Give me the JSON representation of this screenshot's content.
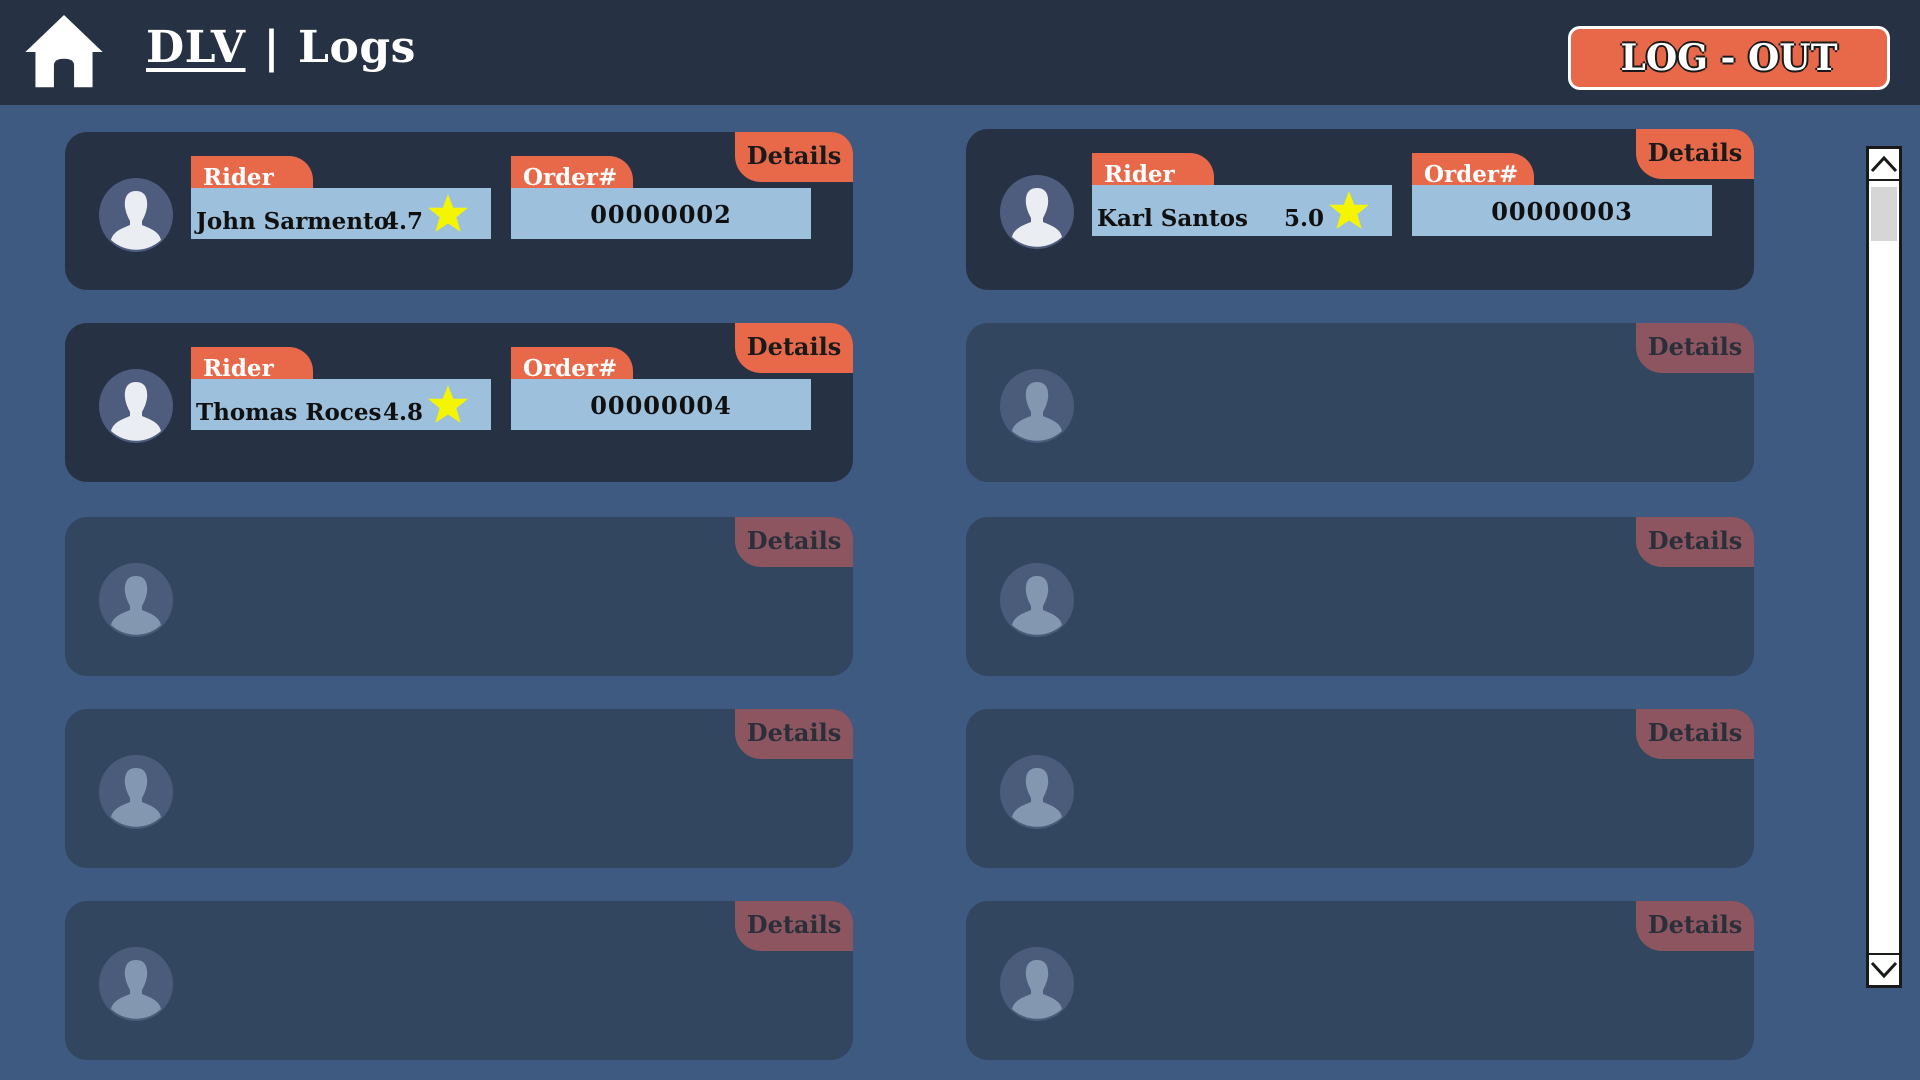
{
  "header": {
    "brand": "DLV",
    "separator": "|",
    "title": "Logs",
    "logout_label": "LOG - OUT"
  },
  "cards": [
    {
      "details_label": "Details",
      "rider_label": "Rider",
      "order_label": "Order#",
      "rider_name": "John Sarmento",
      "rating": "4.7",
      "order_number": "00000002"
    },
    {
      "details_label": "Details",
      "rider_label": "Rider",
      "order_label": "Order#",
      "rider_name": "Karl Santos",
      "rating": "5.0",
      "order_number": "00000003"
    },
    {
      "details_label": "Details",
      "rider_label": "Rider",
      "order_label": "Order#",
      "rider_name": "Thomas Roces",
      "rating": "4.8",
      "order_number": "00000004"
    },
    {
      "details_label": "Details"
    },
    {
      "details_label": "Details"
    },
    {
      "details_label": "Details"
    },
    {
      "details_label": "Details"
    },
    {
      "details_label": "Details"
    },
    {
      "details_label": "Details"
    },
    {
      "details_label": "Details"
    }
  ],
  "icons": [
    "home-icon",
    "avatar-icon",
    "star-icon",
    "chevron-up-icon",
    "chevron-down-icon"
  ],
  "colors": {
    "background": "#3e5a80",
    "header": "#263143",
    "accent": "#e8694a",
    "field": "#9dc1dd",
    "star": "#f5f500",
    "empty_card": "#33465f"
  }
}
